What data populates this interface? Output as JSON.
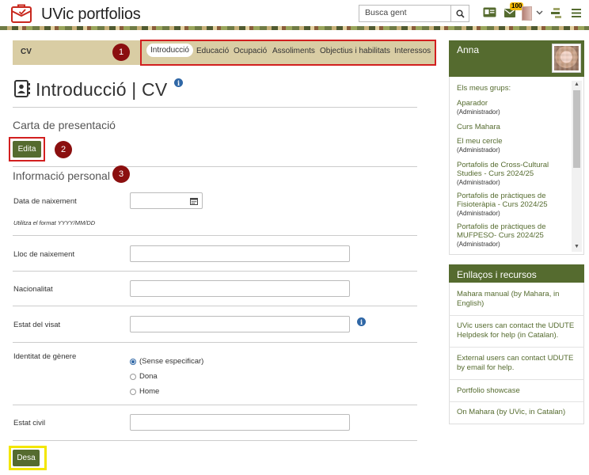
{
  "header": {
    "site_title": "UVic portfolios",
    "search_placeholder": "Busca gent",
    "notification_count": "100"
  },
  "tabs": {
    "cv_label": "CV",
    "items": [
      "Introducció",
      "Educació",
      "Ocupació",
      "Assoliments",
      "Objectius i habilitats",
      "Interessos"
    ],
    "active": "Introducció"
  },
  "markers": [
    "1",
    "2",
    "3"
  ],
  "page": {
    "title": "Introducció | CV"
  },
  "cover": {
    "heading": "Carta de presentació",
    "edit_label": "Edita"
  },
  "personal": {
    "heading": "Informació personal",
    "dob_label": "Data de naixement",
    "dob_hint": "Utilitza el format YYYY/MM/DD",
    "birthplace_label": "Lloc de naixement",
    "nationality_label": "Nacionalitat",
    "visa_label": "Estat del visat",
    "gender_label": "Identitat de gènere",
    "gender_options": [
      "(Sense especificar)",
      "Dona",
      "Home"
    ],
    "gender_selected": "(Sense especificar)",
    "marital_label": "Estat civil",
    "save_label": "Desa"
  },
  "sidebar": {
    "user_name": "Anna",
    "groups_title": "Els meus grups:",
    "groups": [
      {
        "name": "Aparador",
        "role": "(Administrador)"
      },
      {
        "name": "Curs Mahara",
        "role": ""
      },
      {
        "name": "El meu cercle",
        "role": "(Administrador)"
      },
      {
        "name": "Portafolis de Cross-Cultural Studies - Curs 2024/25",
        "role": "(Administrador)"
      },
      {
        "name": "Portafolis de pràctiques de Fisioteràpia - Curs 2024/25",
        "role": "(Administrador)"
      },
      {
        "name": "Portafolis de pràctiques de MUFPESO- Curs 2024/25",
        "role": "(Administrador)"
      }
    ],
    "links_title": "Enllaços i recursos",
    "links": [
      "Mahara manual (by Mahara, in English)",
      "UVic users can contact the UDUTE Helpdesk for help (in Catalan).",
      "External users can contact UDUTE by email for help.",
      "Portfolio showcase",
      "On Mahara (by UVic, in Catalan)"
    ]
  },
  "colors": {
    "accent": "#556b2f",
    "tab_bar": "#d9cda4",
    "marker": "#8b0f0f",
    "highlight_red": "#d21f1f",
    "highlight_yellow": "#f3e600",
    "info": "#2f67a6"
  }
}
